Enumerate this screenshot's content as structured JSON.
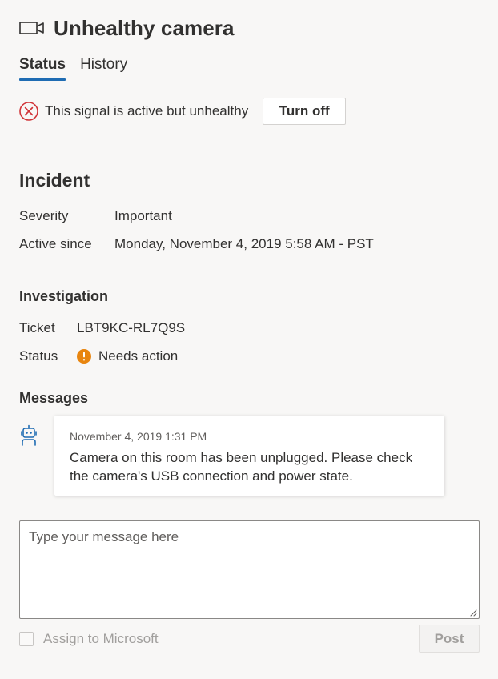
{
  "header": {
    "icon": "video-camera-icon",
    "title": "Unhealthy camera"
  },
  "tabs": [
    {
      "label": "Status",
      "active": true
    },
    {
      "label": "History",
      "active": false
    }
  ],
  "signal": {
    "icon": "error-circle-icon",
    "status_color": "#d13438",
    "text": "This signal is active but unhealthy",
    "button_label": "Turn off"
  },
  "incident": {
    "heading": "Incident",
    "severity_label": "Severity",
    "severity_value": "Important",
    "active_since_label": "Active since",
    "active_since_value": "Monday, November 4, 2019 5:58 AM - PST"
  },
  "investigation": {
    "heading": "Investigation",
    "ticket_label": "Ticket",
    "ticket_value": "LBT9KC-RL7Q9S",
    "status_label": "Status",
    "status_icon": "warning-icon",
    "status_color": "#e8850f",
    "status_value": "Needs action"
  },
  "messages": {
    "heading": "Messages",
    "items": [
      {
        "avatar_icon": "bot-icon",
        "date": "November 4, 2019 1:31 PM",
        "text": "Camera on this room has been unplugged. Please check the camera's USB connection and power state."
      }
    ]
  },
  "composer": {
    "placeholder": "Type your message here",
    "value": "",
    "assign_label": "Assign to Microsoft",
    "assign_checked": false,
    "post_label": "Post"
  },
  "colors": {
    "accent": "#1f6cb3",
    "background": "#f8f7f6"
  }
}
